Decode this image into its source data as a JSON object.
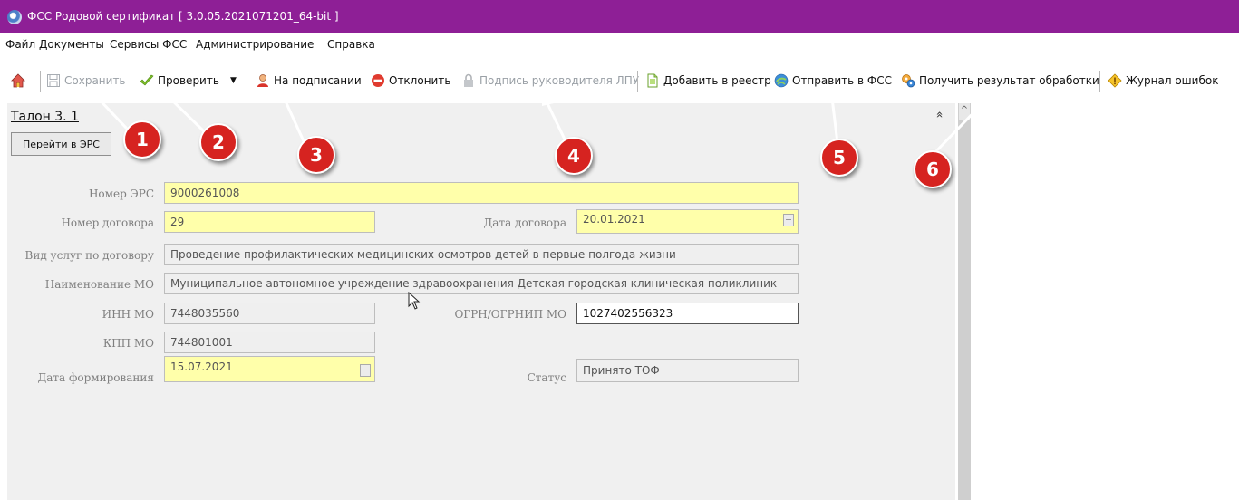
{
  "window": {
    "title": "ФСС Родовой сертификат  [ 3.0.05.2021071201_64-bit ]"
  },
  "menu": [
    "Файл",
    "Документы",
    "Сервисы ФСС",
    "Администрирование",
    "Справка"
  ],
  "toolbar": {
    "save": "Сохранить",
    "check": "Проверить",
    "on_signing": "На подписании",
    "reject": "Отклонить",
    "sign_head": "Подпись руководителя ЛПУ",
    "add_registry": "Добавить в реестр",
    "send_fss": "Отправить в ФСС",
    "get_result": "Получить результат обработки",
    "error_log": "Журнал ошибок"
  },
  "section": {
    "title": "Талон 3. 1",
    "goto_button": "Перейти в ЭРС",
    "collapse_glyph": "»"
  },
  "form": {
    "ers_number": {
      "label": "Номер ЭРС",
      "value": "9000261008"
    },
    "contract_number": {
      "label": "Номер договора",
      "value": "29"
    },
    "contract_date": {
      "label": "Дата договора",
      "value": "20.01.2021"
    },
    "service_type": {
      "label": "Вид услуг по договору",
      "value": "Проведение профилактических медицинских осмотров детей в первые полгода жизни"
    },
    "mo_name": {
      "label": "Наименование МО",
      "value": "Муниципальное автономное учреждение здравоохранения Детская городская клиническая поликлиник"
    },
    "inn": {
      "label": "ИНН МО",
      "value": "7448035560"
    },
    "ogrn": {
      "label": "ОГРН/ОГРНИП МО",
      "value": "1027402556323"
    },
    "kpp": {
      "label": "КПП МО",
      "value": "744801001"
    },
    "formation_date": {
      "label": "Дата формирования",
      "value": "15.07.2021"
    },
    "status": {
      "label": "Статус",
      "value": "Принято ТОФ"
    }
  },
  "callouts": [
    "1",
    "2",
    "3",
    "4",
    "5",
    "6"
  ],
  "colors": {
    "titlebar": "#8e1f96",
    "required_field": "#ffffaa",
    "callout": "#d62320"
  }
}
